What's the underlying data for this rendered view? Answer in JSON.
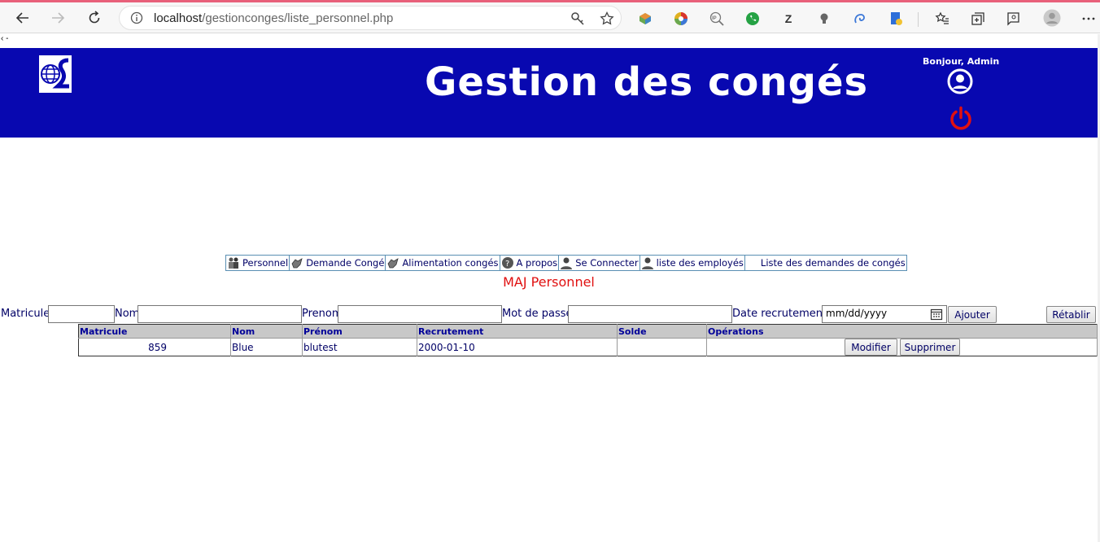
{
  "browser": {
    "url_host": "localhost",
    "url_path": "/gestionconges/liste_personnel.php",
    "extensions": [
      "Z"
    ]
  },
  "strip_text": "‹ -",
  "header": {
    "title": "Gestion des congés",
    "greeting": "Bonjour, Admin"
  },
  "menu": {
    "items": [
      {
        "label": "Personnel",
        "icon": "people-icon"
      },
      {
        "label": "Demande Congé",
        "icon": "hand-icon"
      },
      {
        "label": "Alimentation congés",
        "icon": "hand-icon"
      },
      {
        "label": "A propos",
        "icon": "help-icon"
      },
      {
        "label": "Se Connecter",
        "icon": "user-icon"
      },
      {
        "label": "liste des employés",
        "icon": "user-icon"
      },
      {
        "label": "Liste des demandes de congés",
        "icon": ""
      }
    ]
  },
  "section_title": "MAJ Personnel",
  "form": {
    "matricule_label": "Matricule",
    "nom_label": "Nom",
    "prenom_label": "Prenom",
    "password_label": "Mot de passe",
    "date_label": "Date recrutement",
    "date_placeholder": "mm/dd/yyyy",
    "add_label": "Ajouter",
    "reset_label": "Rétablir"
  },
  "table": {
    "headers": [
      "Matricule",
      "Nom",
      "Prénom",
      "Recrutement",
      "Solde",
      "Opérations"
    ],
    "rows": [
      {
        "matricule": "859",
        "nom": "Blue",
        "prenom": "blutest",
        "recrutement": "2000-01-10",
        "solde": ""
      }
    ],
    "modify_label": "Modifier",
    "delete_label": "Supprimer"
  },
  "colors": {
    "header_bg": "#0808b0",
    "title_red": "#e01010",
    "power_red": "#e01010",
    "text_navy": "#000066"
  }
}
